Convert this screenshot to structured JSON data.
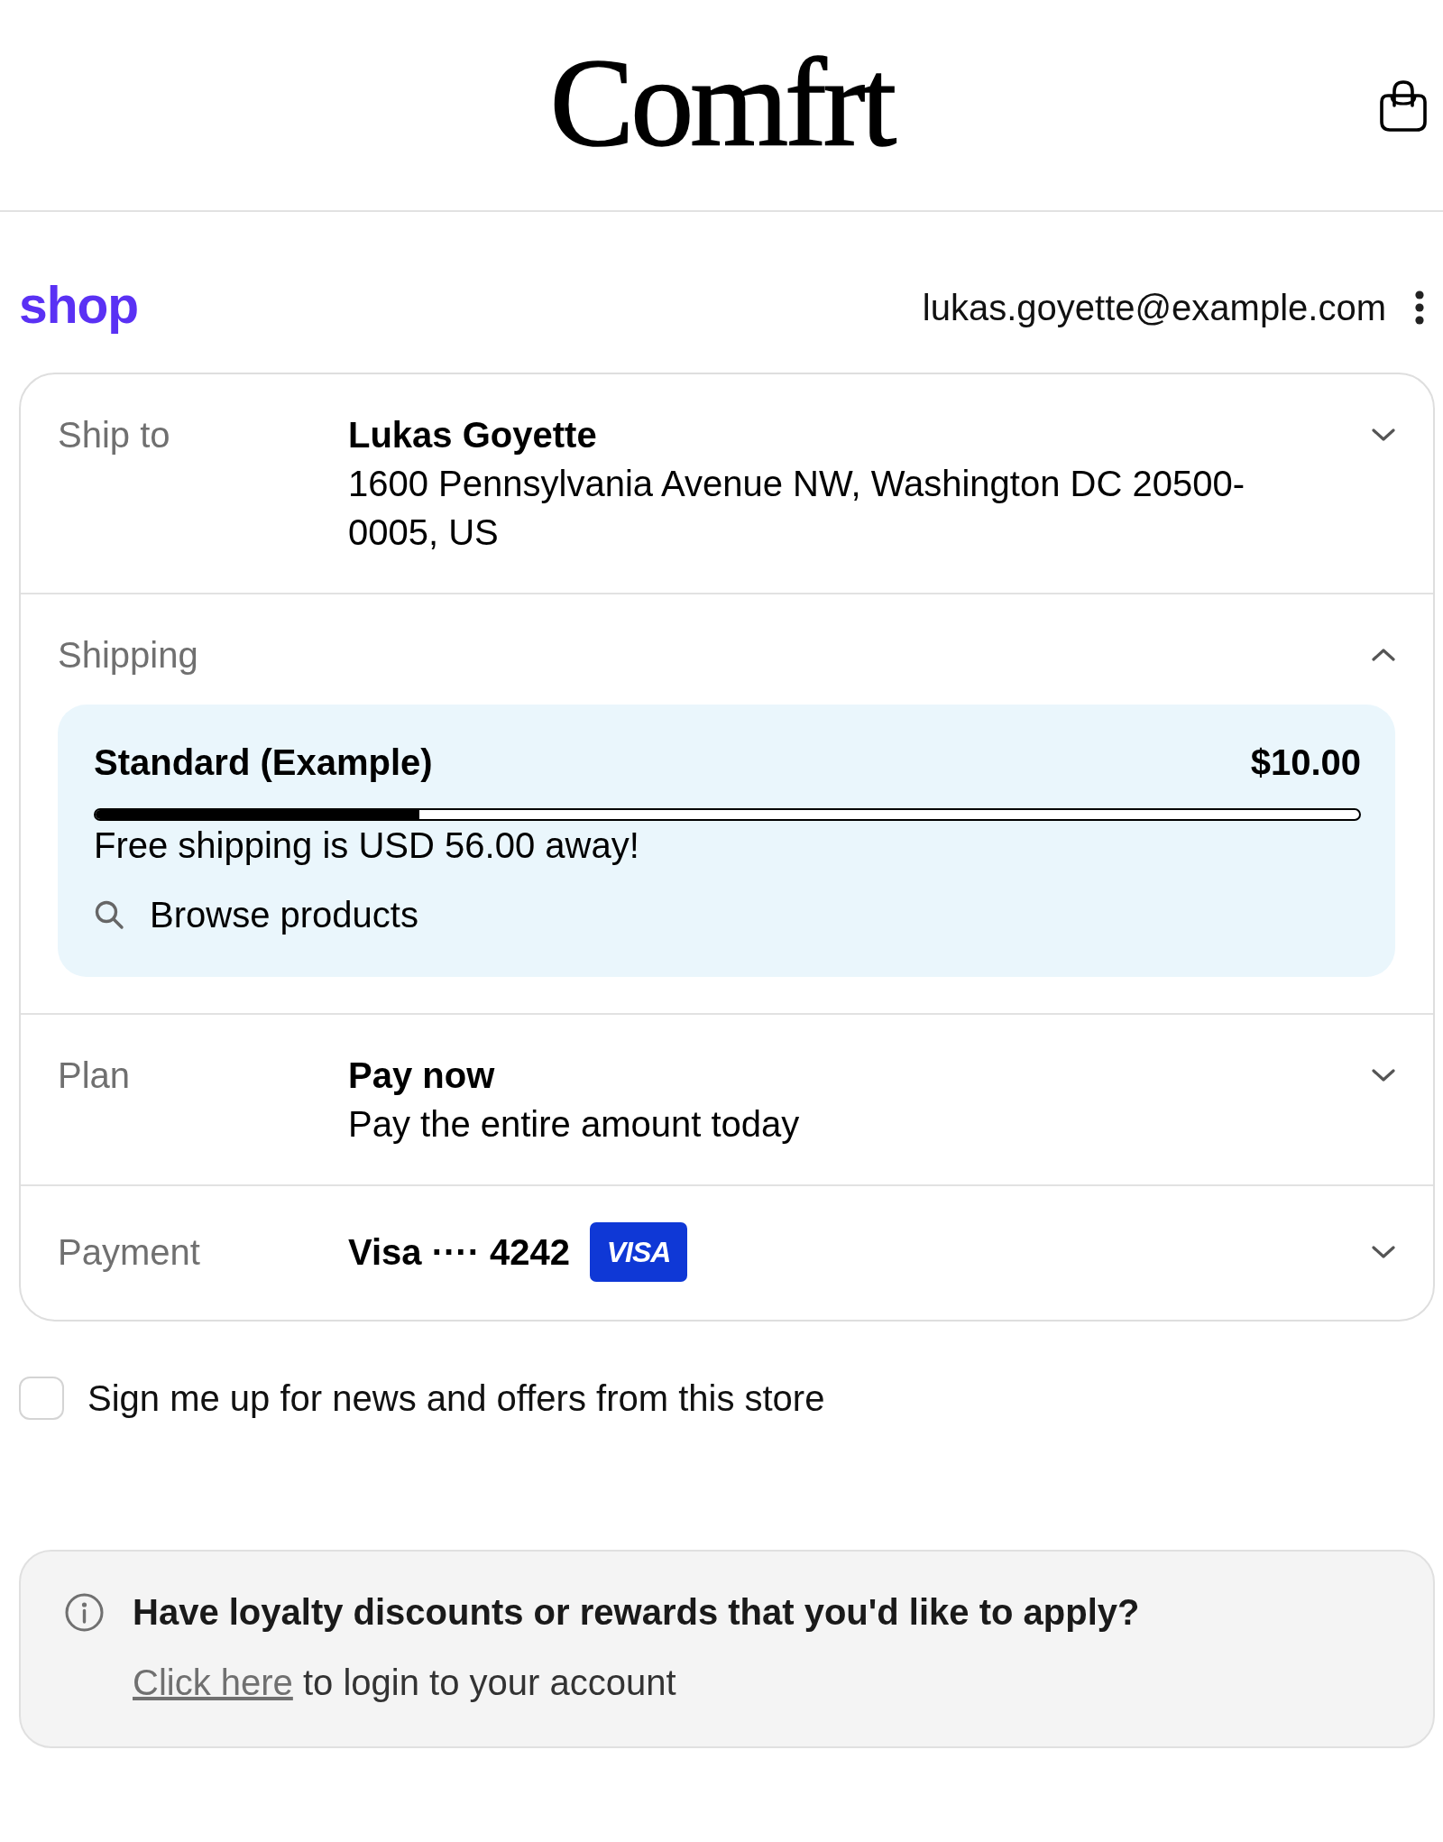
{
  "header": {
    "logo": "Comfrt"
  },
  "account": {
    "logo": "shop",
    "email": "lukas.goyette@example.com"
  },
  "sections": [
    {
      "kind": "summary",
      "label": "Ship to",
      "title": "Lukas Goyette",
      "detail": "1600 Pennsylvania Avenue NW, Washington DC 20500-0005, US",
      "expanded": false
    },
    {
      "kind": "shipping",
      "label": "Shipping",
      "expanded": true,
      "option": {
        "name": "Standard (Example)",
        "price": "$10.00",
        "level": 0.256,
        "message": "Free shipping is USD 56.00 away!",
        "link": "Browse products"
      }
    },
    {
      "kind": "summary",
      "label": "Plan",
      "title": "Pay now",
      "detail": "Pay the entire amount today",
      "expanded": false
    },
    {
      "kind": "payment",
      "label": "Payment",
      "title": "Visa ···· 4242",
      "card_brand": "VISA",
      "expanded": false
    }
  ],
  "newsletter": {
    "label": "Sign me up for news and offers from this store",
    "checked": false
  },
  "loyalty": {
    "heading": "Have loyalty discounts or rewards that you'd like to apply?",
    "link": "Click here",
    "text": "to login to your account"
  }
}
